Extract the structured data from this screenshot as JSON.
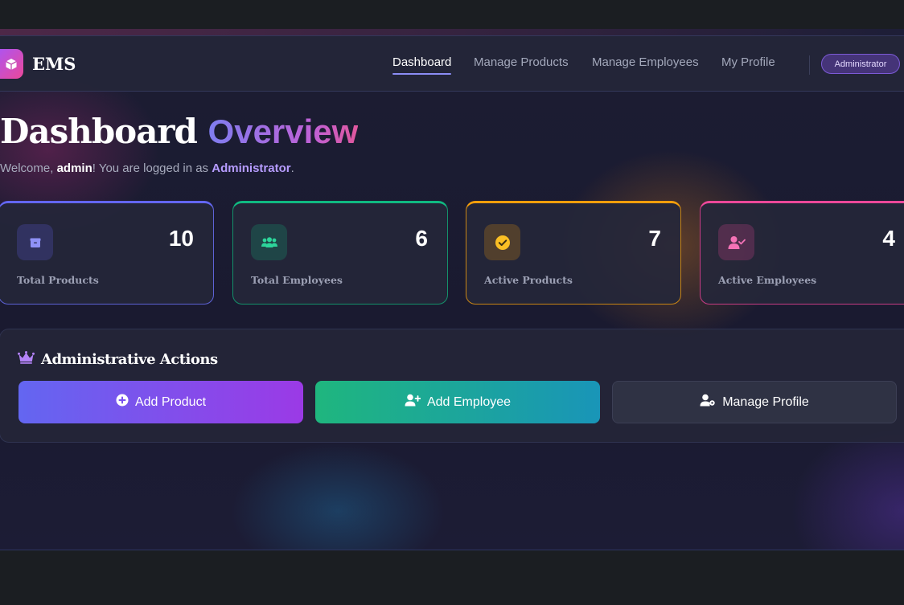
{
  "header": {
    "brand": "EMS",
    "nav": [
      {
        "label": "Dashboard",
        "active": true
      },
      {
        "label": "Manage Products",
        "active": false
      },
      {
        "label": "Manage Employees",
        "active": false
      },
      {
        "label": "My Profile",
        "active": false
      }
    ],
    "role_badge": "Administrator"
  },
  "page": {
    "title_main": "Dashboard",
    "title_accent": "Overview",
    "welcome_prefix": "Welcome, ",
    "username": "admin",
    "welcome_middle": "! You are logged in as ",
    "role": "Administrator",
    "welcome_suffix": "."
  },
  "stats": [
    {
      "label": "Total Products",
      "value": "10",
      "icon": "box-icon",
      "color": "#6366f1"
    },
    {
      "label": "Total Employees",
      "value": "6",
      "icon": "users-icon",
      "color": "#10b981"
    },
    {
      "label": "Active Products",
      "value": "7",
      "icon": "check-circle-icon",
      "color": "#f59e0b"
    },
    {
      "label": "Active Employees",
      "value": "4",
      "icon": "user-check-icon",
      "color": "#ec4899"
    }
  ],
  "actions": {
    "title": "Administrative Actions",
    "buttons": [
      {
        "label": "Add Product",
        "icon": "plus-circle-icon"
      },
      {
        "label": "Add Employee",
        "icon": "user-plus-icon"
      },
      {
        "label": "Manage Profile",
        "icon": "user-gear-icon"
      }
    ]
  }
}
